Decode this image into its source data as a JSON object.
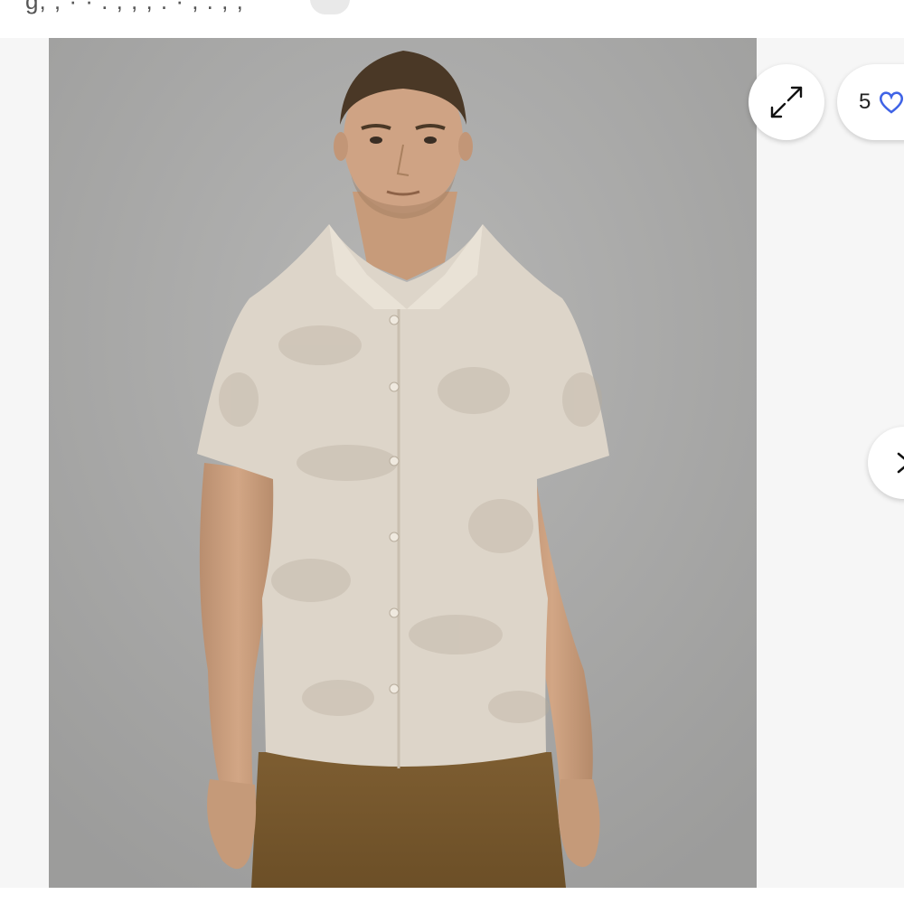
{
  "favorites": {
    "count": "5",
    "icon": "heart-icon",
    "icon_color": "#3f63e6"
  },
  "controls": {
    "expand_icon": "expand-diagonal-arrows-icon",
    "next_icon": "chevron-right-icon"
  },
  "colors": {
    "image_background": "#a9a9a8",
    "shirt": "#ddd5c9",
    "pants": "#7a5a2e"
  }
}
